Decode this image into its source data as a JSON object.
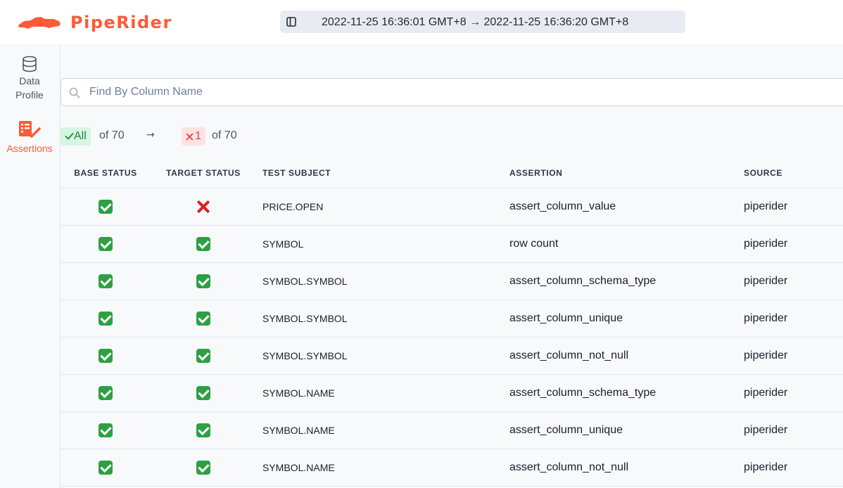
{
  "brand": {
    "name": "PipeRider",
    "color": "#ff5a36"
  },
  "header": {
    "run_range": "2022-11-25 16:36:01 GMT+8 → 2022-11-25 16:36:20 GMT+8",
    "toggle_icon": "sidebar-panel-icon"
  },
  "sidebar": {
    "items": [
      {
        "label_line1": "Data",
        "label_line2": "Profile",
        "icon": "database-icon",
        "active": false
      },
      {
        "label": "Assertions",
        "icon": "assertion-checklist-icon",
        "active": true
      }
    ]
  },
  "search": {
    "placeholder": "Find By Column Name",
    "value": ""
  },
  "filters": {
    "base": {
      "badge": "All",
      "of_text": "of  70"
    },
    "arrow": "→",
    "target": {
      "badge": "1",
      "of_text": "of  70"
    }
  },
  "table": {
    "columns": [
      "BASE STATUS",
      "TARGET STATUS",
      "TEST SUBJECT",
      "ASSERTION",
      "SOURCE"
    ],
    "rows": [
      {
        "base_status": "passed",
        "target_status": "failed",
        "subject": "PRICE.OPEN",
        "assertion": "assert_column_value",
        "source": "piperider"
      },
      {
        "base_status": "passed",
        "target_status": "passed",
        "subject": "SYMBOL",
        "assertion": "row count",
        "source": "piperider"
      },
      {
        "base_status": "passed",
        "target_status": "passed",
        "subject": "SYMBOL.SYMBOL",
        "assertion": "assert_column_schema_type",
        "source": "piperider"
      },
      {
        "base_status": "passed",
        "target_status": "passed",
        "subject": "SYMBOL.SYMBOL",
        "assertion": "assert_column_unique",
        "source": "piperider"
      },
      {
        "base_status": "passed",
        "target_status": "passed",
        "subject": "SYMBOL.SYMBOL",
        "assertion": "assert_column_not_null",
        "source": "piperider"
      },
      {
        "base_status": "passed",
        "target_status": "passed",
        "subject": "SYMBOL.NAME",
        "assertion": "assert_column_schema_type",
        "source": "piperider"
      },
      {
        "base_status": "passed",
        "target_status": "passed",
        "subject": "SYMBOL.NAME",
        "assertion": "assert_column_unique",
        "source": "piperider"
      },
      {
        "base_status": "passed",
        "target_status": "passed",
        "subject": "SYMBOL.NAME",
        "assertion": "assert_column_not_null",
        "source": "piperider"
      }
    ]
  }
}
